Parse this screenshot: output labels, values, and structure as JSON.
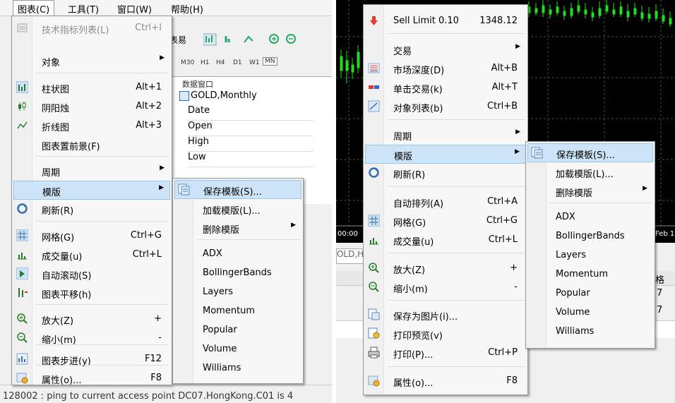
{
  "left": {
    "menubar": [
      {
        "label": "图表(C)",
        "active": true
      },
      {
        "label": "工具(T)"
      },
      {
        "label": "窗口(W)"
      },
      {
        "label": "帮助(H)"
      }
    ],
    "chart_menu": [
      {
        "label": "技术指标列表(L)",
        "shortcut": "Ctrl+I",
        "disabled": true,
        "icon": "indicator-list-icon"
      },
      {
        "label": "对象",
        "submenu": true
      },
      {
        "label": "柱状图",
        "shortcut": "Alt+1",
        "icon": "bar-chart-icon"
      },
      {
        "label": "阴阳烛",
        "shortcut": "Alt+2",
        "icon": "candlestick-icon"
      },
      {
        "label": "折线图",
        "shortcut": "Alt+3",
        "icon": "line-chart-icon"
      },
      {
        "label": "图表置前景(F)"
      },
      {
        "label": "周期",
        "submenu": true
      },
      {
        "label": "模版",
        "submenu": true,
        "highlight": true
      },
      {
        "label": "刷新(R)",
        "icon": "refresh-icon"
      },
      {
        "label": "网格(G)",
        "shortcut": "Ctrl+G",
        "icon": "grid-icon"
      },
      {
        "label": "成交量(u)",
        "shortcut": "Ctrl+L",
        "icon": "volume-icon"
      },
      {
        "label": "自动滚动(S)",
        "icon": "autoscroll-icon"
      },
      {
        "label": "图表平移(h)",
        "icon": "chart-shift-icon"
      },
      {
        "label": "放大(Z)",
        "shortcut": "+",
        "icon": "zoom-in-icon"
      },
      {
        "label": "缩小(m)",
        "shortcut": "-",
        "icon": "zoom-out-icon"
      },
      {
        "label": "图表步进(y)",
        "shortcut": "F12",
        "icon": "step-icon"
      },
      {
        "label": "属性(o)...",
        "shortcut": "F8",
        "icon": "properties-icon"
      }
    ],
    "template_submenu": [
      {
        "label": "保存模板(S)...",
        "highlight": true,
        "icon": "save-template-icon"
      },
      {
        "label": "加载模版(L)..."
      },
      {
        "label": "删除模版",
        "submenu": true
      },
      {
        "label": "ADX"
      },
      {
        "label": "BollingerBands"
      },
      {
        "label": "Layers"
      },
      {
        "label": "Momentum"
      },
      {
        "label": "Popular"
      },
      {
        "label": "Volume"
      },
      {
        "label": "Williams"
      }
    ],
    "toolbar_text": "表易",
    "timeframes": [
      "M30",
      "H1",
      "H4",
      "D1",
      "W1",
      "MN"
    ],
    "data_window": {
      "title": "数据窗口",
      "symbol": "GOLD,Monthly",
      "rows": [
        "Date",
        "Open",
        "High",
        "Low"
      ]
    },
    "status_text": "128002 : ping to current access point DC07.HongKong.C01 is 4"
  },
  "right": {
    "context_menu": [
      {
        "label": "Sell Limit 0.10",
        "shortcut": "1348.12",
        "icon": "sell-arrow-icon"
      },
      {
        "label": "交易",
        "submenu": true
      },
      {
        "label": "市场深度(D)",
        "shortcut": "Alt+B",
        "icon": "market-depth-icon"
      },
      {
        "label": "单击交易(k)",
        "shortcut": "Alt+T",
        "icon": "one-click-icon"
      },
      {
        "label": "对象列表(b)",
        "shortcut": "Ctrl+B",
        "icon": "object-list-icon"
      },
      {
        "label": "周期",
        "submenu": true
      },
      {
        "label": "模版",
        "submenu": true,
        "highlight": true
      },
      {
        "label": "刷新(R)",
        "icon": "refresh-icon"
      },
      {
        "label": "自动排列(A)",
        "shortcut": "Ctrl+A"
      },
      {
        "label": "网格(G)",
        "shortcut": "Ctrl+G",
        "icon": "grid-icon"
      },
      {
        "label": "成交量(u)",
        "shortcut": "Ctrl+L",
        "icon": "volume-icon"
      },
      {
        "label": "放大(Z)",
        "shortcut": "+",
        "icon": "zoom-in-icon"
      },
      {
        "label": "缩小(m)",
        "shortcut": "-",
        "icon": "zoom-out-icon"
      },
      {
        "label": "保存为图片(i)...",
        "icon": "save-image-icon"
      },
      {
        "label": "打印预览(v)",
        "icon": "print-preview-icon"
      },
      {
        "label": "打印(P)...",
        "shortcut": "Ctrl+P",
        "icon": "print-icon"
      },
      {
        "label": "属性(o)...",
        "shortcut": "F8",
        "icon": "properties-icon"
      }
    ],
    "template_submenu": [
      {
        "label": "保存模板(S)...",
        "highlight": true,
        "icon": "save-template-icon"
      },
      {
        "label": "加载模版(L)..."
      },
      {
        "label": "删除模版",
        "submenu": true
      },
      {
        "label": "ADX"
      },
      {
        "label": "BollingerBands"
      },
      {
        "label": "Layers"
      },
      {
        "label": "Momentum"
      },
      {
        "label": "Popular"
      },
      {
        "label": "Volume"
      },
      {
        "label": "Williams"
      }
    ],
    "axis_left": "00:00",
    "axis_right": "Feb 1",
    "tab_text": "OLD,H",
    "table_cells": [
      "格",
      "7",
      "7"
    ]
  },
  "colors": {
    "highlight_bg": "#cde3f7",
    "highlight_border": "#99c5ed",
    "candle_green": "#22dd22",
    "chart_bg": "#000000"
  }
}
